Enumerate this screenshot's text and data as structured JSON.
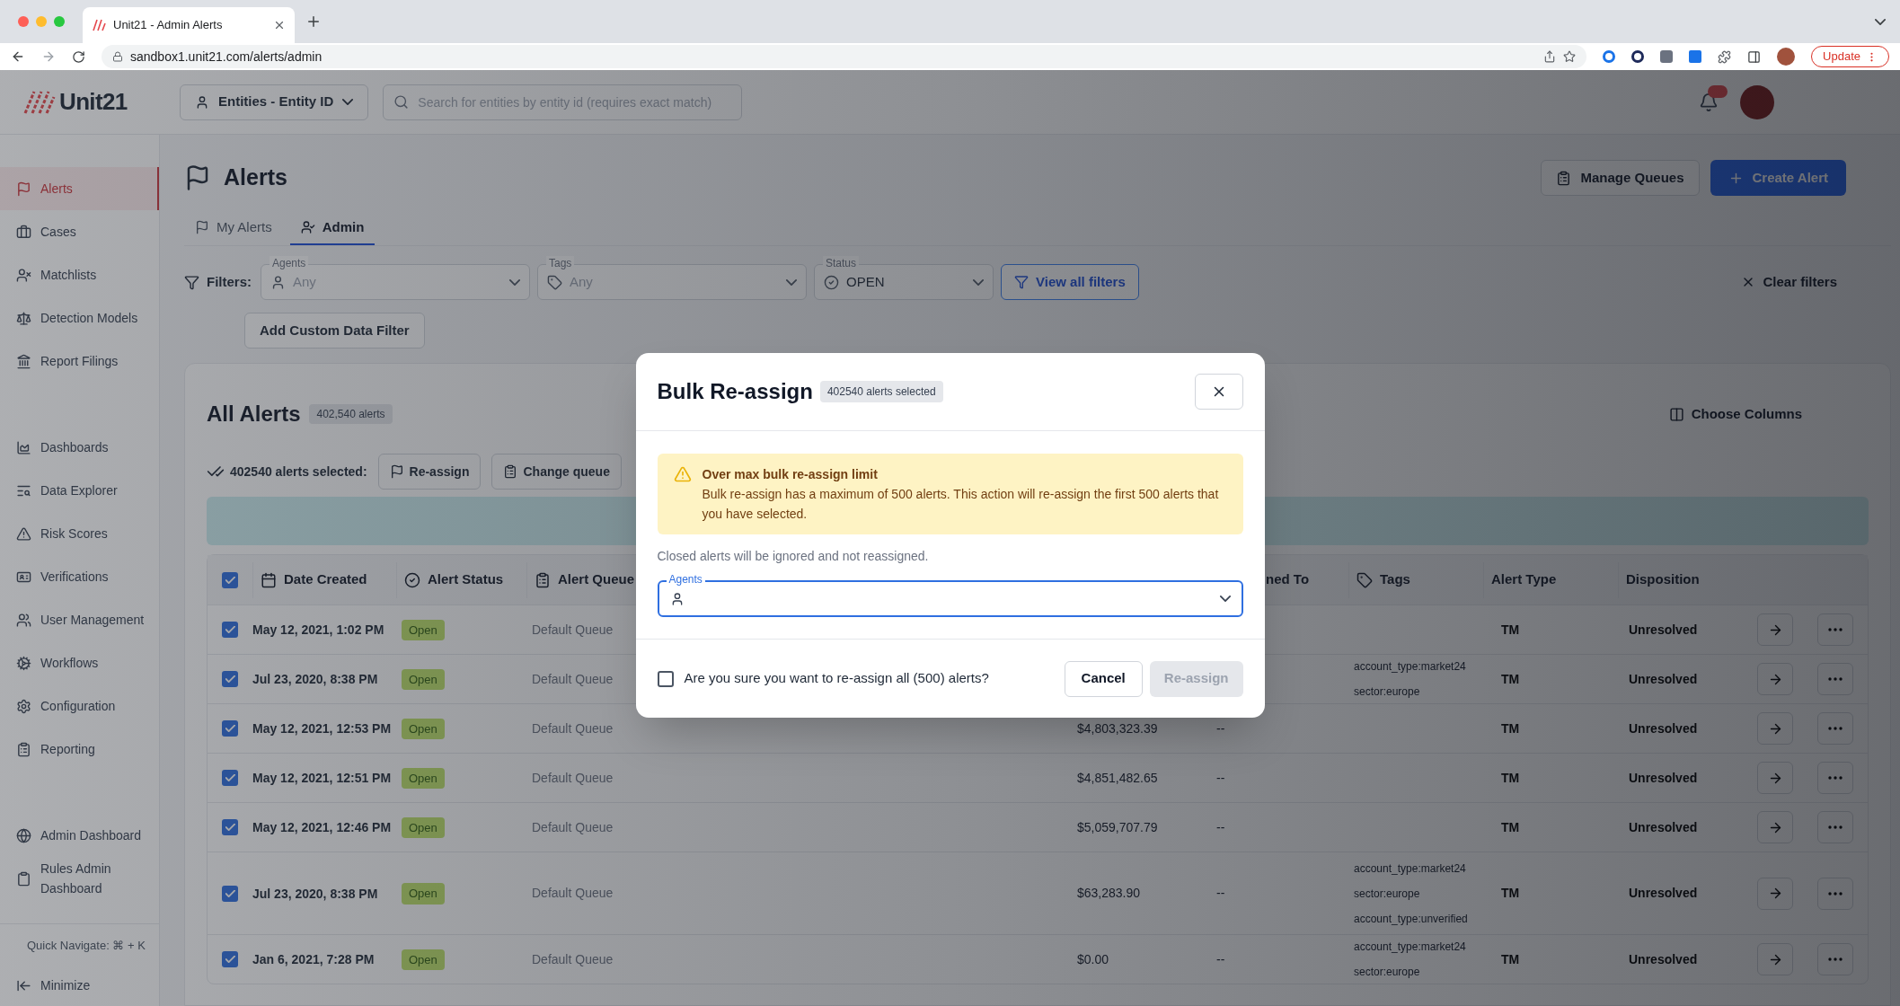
{
  "browser": {
    "tab_title": "Unit21 - Admin Alerts",
    "url": "sandbox1.unit21.com/alerts/admin",
    "update_button": "Update"
  },
  "header": {
    "logo": "Unit21",
    "entity_select": "Entities - Entity ID",
    "search": {
      "placeholder": "Search for entities by entity id (requires exact match)"
    }
  },
  "sidebar": {
    "sections": [
      {
        "items": [
          {
            "label": "Alerts",
            "selected": true
          },
          {
            "label": "Cases",
            "selected": false
          },
          {
            "label": "Matchlists",
            "selected": false
          },
          {
            "label": "Detection Models",
            "selected": false
          },
          {
            "label": "Report Filings",
            "selected": false
          }
        ]
      },
      {
        "items": [
          {
            "label": "Dashboards",
            "selected": false
          },
          {
            "label": "Data Explorer",
            "selected": false
          },
          {
            "label": "Risk Scores",
            "selected": false
          },
          {
            "label": "Verifications",
            "selected": false
          },
          {
            "label": "User Management",
            "selected": false
          },
          {
            "label": "Workflows",
            "selected": false
          },
          {
            "label": "Configuration",
            "selected": false
          },
          {
            "label": "Reporting",
            "selected": false
          }
        ]
      },
      {
        "items": [
          {
            "label": "Admin Dashboard",
            "selected": false
          },
          {
            "label": "Rules Admin Dashboard",
            "selected": false
          }
        ]
      }
    ],
    "quick_navigate": "Quick Navigate: ⌘ + K",
    "minimize": "Minimize"
  },
  "page": {
    "title": "Alerts",
    "actions": [
      "Manage Queues",
      "Create Alert"
    ],
    "tabs": [
      {
        "label": "My Alerts",
        "selected": false
      },
      {
        "label": "Admin",
        "selected": true
      }
    ],
    "filters": {
      "label": "Filters:",
      "fields": [
        {
          "label": "Agents",
          "value": "Any"
        },
        {
          "label": "Tags",
          "value": "Any"
        },
        {
          "label": "Status",
          "value": "OPEN"
        }
      ],
      "view_all": "View all filters",
      "clear": "Clear filters",
      "add_custom": "Add Custom Data Filter"
    }
  },
  "card": {
    "title": "All Alerts",
    "count": "402,540 alerts",
    "choose_columns": "Choose Columns",
    "selection": "402540 alerts selected:",
    "bulk_actions": [
      "Re-assign",
      "Change queue"
    ]
  },
  "table": {
    "all_checked": true,
    "columns": [
      {
        "label": "Date Created"
      },
      {
        "label": "Alert Status"
      },
      {
        "label": "Alert Queue"
      },
      {
        "label": "ned To"
      },
      {
        "label": "Tags"
      },
      {
        "label": "Alert Type"
      },
      {
        "label": "Disposition"
      }
    ],
    "rows": [
      {
        "checked": true,
        "date": "May 12, 2021, 1:02 PM",
        "status": "Open",
        "queue": "Default Queue",
        "type": "TM",
        "disposition": "Unresolved"
      },
      {
        "checked": true,
        "date": "Jul 23, 2020, 8:38 PM",
        "status": "Open",
        "queue": "Default Queue",
        "tags": [
          "account_type:market24",
          "sector:europe"
        ],
        "type": "TM",
        "disposition": "Unresolved"
      },
      {
        "checked": true,
        "date": "May 12, 2021, 12:53 PM",
        "status": "Open",
        "queue": "Default Queue",
        "amount": "$4,803,323.39",
        "assigned": "--",
        "type": "TM",
        "disposition": "Unresolved"
      },
      {
        "checked": true,
        "date": "May 12, 2021, 12:51 PM",
        "status": "Open",
        "queue": "Default Queue",
        "amount": "$4,851,482.65",
        "assigned": "--",
        "type": "TM",
        "disposition": "Unresolved"
      },
      {
        "checked": true,
        "date": "May 12, 2021, 12:46 PM",
        "status": "Open",
        "queue": "Default Queue",
        "amount": "$5,059,707.79",
        "assigned": "--",
        "type": "TM",
        "disposition": "Unresolved"
      },
      {
        "checked": true,
        "date": "Jul 23, 2020, 8:38 PM",
        "status": "Open",
        "queue": "Default Queue",
        "amount": "$63,283.90",
        "assigned": "--",
        "tags": [
          "account_type:market24",
          "sector:europe",
          "account_type:unverified"
        ],
        "type": "TM",
        "disposition": "Unresolved"
      },
      {
        "checked": true,
        "date": "Jan 6, 2021, 7:28 PM",
        "status": "Open",
        "queue": "Default Queue",
        "amount": "$0.00",
        "assigned": "--",
        "tags": [
          "account_type:market24",
          "sector:europe"
        ],
        "type": "TM",
        "disposition": "Unresolved"
      }
    ]
  },
  "modal": {
    "title": "Bulk Re-assign",
    "badge": "402540 alerts selected",
    "warning": {
      "title": "Over max bulk re-assign limit",
      "body": "Bulk re-assign has a maximum of 500 alerts. This action will re-assign the first 500 alerts that you have selected."
    },
    "note": "Closed alerts will be ignored and not reassigned.",
    "agents_field": {
      "label": "Agents"
    },
    "confirm": {
      "label": "Are you sure you want to re-assign all (500) alerts?",
      "checked": false
    },
    "cancel": "Cancel",
    "submit": {
      "label": "Re-assign",
      "disabled": true
    }
  }
}
